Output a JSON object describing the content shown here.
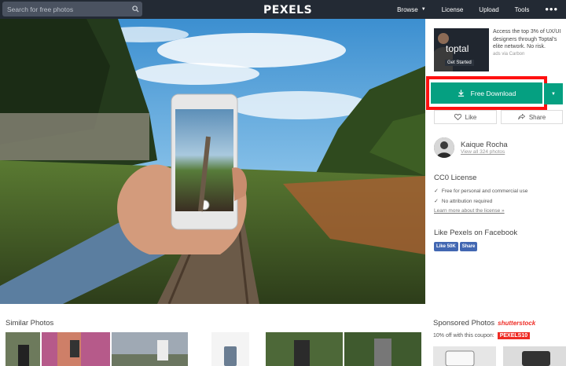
{
  "header": {
    "search_placeholder": "Search for free photos",
    "logo": "PEXELS",
    "nav": [
      {
        "label": "Browse"
      },
      {
        "label": "License"
      },
      {
        "label": "Upload"
      },
      {
        "label": "Tools"
      }
    ]
  },
  "ad": {
    "brand": "toptal",
    "cta": "Get Started",
    "copy": "Access the top 3% of UX/UI designers through Toptal's elite network. No risk.",
    "via": "ads via Carbon"
  },
  "download": {
    "label": "Free Download"
  },
  "actions": {
    "like": "Like",
    "share": "Share"
  },
  "author": {
    "name": "Kaique Rocha",
    "link": "View all 324 photos"
  },
  "license": {
    "title": "CC0 License",
    "points": [
      "Free for personal and commercial use",
      "No attribution required"
    ],
    "link": "Learn more about the license »"
  },
  "facebook": {
    "title": "Like Pexels on Facebook",
    "like_label": "Like 50K",
    "share_label": "Share"
  },
  "similar": {
    "title": "Similar Photos"
  },
  "sponsored": {
    "title": "Sponsored Photos",
    "brand": "shutterstock",
    "coupon_text": "10% off with this coupon:",
    "coupon_code": "PEXELS10"
  },
  "colors": {
    "header_bg": "#232a34",
    "download_green": "#05a081",
    "highlight_red": "#ff1010",
    "facebook_blue": "#4267b2",
    "shutterstock_red": "#ee2b24"
  }
}
